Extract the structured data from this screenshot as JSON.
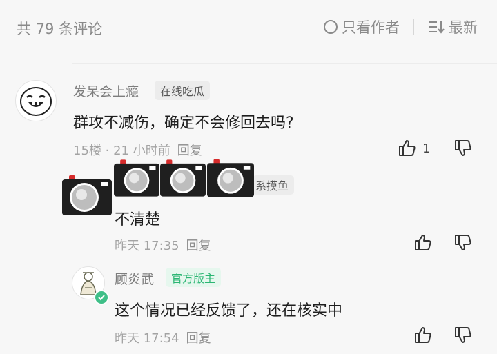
{
  "header": {
    "comment_count": "共 79 条评论",
    "author_only": "只看作者",
    "sort_label": "最新"
  },
  "comments": [
    {
      "username": "发呆会上瘾",
      "badge": "在线吃瓜",
      "content": "群攻不减伤，确定不会修回去吗?",
      "meta": "15楼 · 21 小时前",
      "reply_label": "回复",
      "like_count": "1"
    },
    {
      "username_visible": "系摸鱼",
      "content": "不清楚",
      "meta": "昨天 17:35",
      "reply_label": "回复"
    },
    {
      "username": "顾炎武",
      "badge": "官方版主",
      "content": "这个情况已经反馈了，还在核实中",
      "meta": "昨天 17:54",
      "reply_label": "回复"
    }
  ],
  "colors": {
    "official_badge": "#2bb673",
    "verified": "#3fbf88",
    "camera_red": "#d62b2b"
  }
}
